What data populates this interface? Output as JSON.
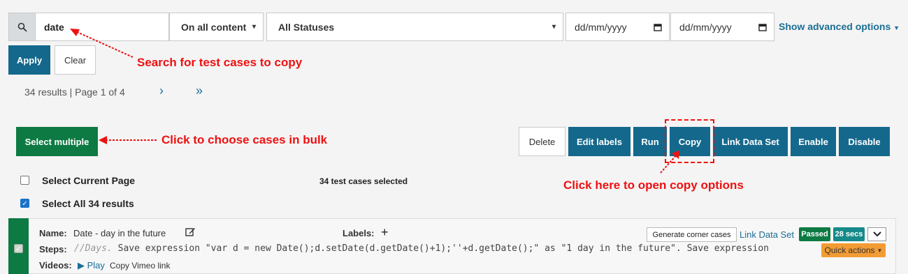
{
  "search": {
    "value": "date",
    "scope": "On all content",
    "status": "All Statuses",
    "date_from_placeholder": "dd/mm/yyyy",
    "date_to_placeholder": "dd/mm/yyyy",
    "advanced_link": "Show advanced options"
  },
  "filters": {
    "apply": "Apply",
    "clear": "Clear"
  },
  "pagination": {
    "summary": "34 results | Page 1 of 4",
    "next": "›",
    "last": "»"
  },
  "toolbar": {
    "select_multiple": "Select multiple",
    "delete": "Delete",
    "edit_labels": "Edit labels",
    "run": "Run",
    "copy": "Copy",
    "link_data_set": "Link Data Set",
    "enable": "Enable",
    "disable": "Disable"
  },
  "selection": {
    "current_page": "Select Current Page",
    "all": "Select All 34 results",
    "selected_count": "34 test cases selected"
  },
  "case": {
    "name_label": "Name:",
    "name": "Date - day in the future",
    "labels_label": "Labels:",
    "labels_add": "+",
    "steps_label": "Steps:",
    "steps_comment": "//Days.",
    "steps_text": " Save expression \"var d = new Date();d.setDate(d.getDate()+1);''+d.getDate();\" as \"1 day in the future\". Save expression",
    "videos_label": "Videos:",
    "play": "Play",
    "copy_vimeo": "Copy Vimeo link",
    "corner_cases": "Generate corner cases",
    "link_data_set": "Link Data Set",
    "status": "Passed",
    "duration": "28 secs",
    "quick_actions": "Quick actions"
  },
  "annotations": {
    "search": "Search for test cases to copy",
    "bulk": "Click to choose cases in bulk",
    "copy": "Click here to open copy options"
  },
  "colors": {
    "teal": "#14688c",
    "green": "#0d7a43",
    "annotation": "#ee1111",
    "orange": "#f39c33"
  }
}
